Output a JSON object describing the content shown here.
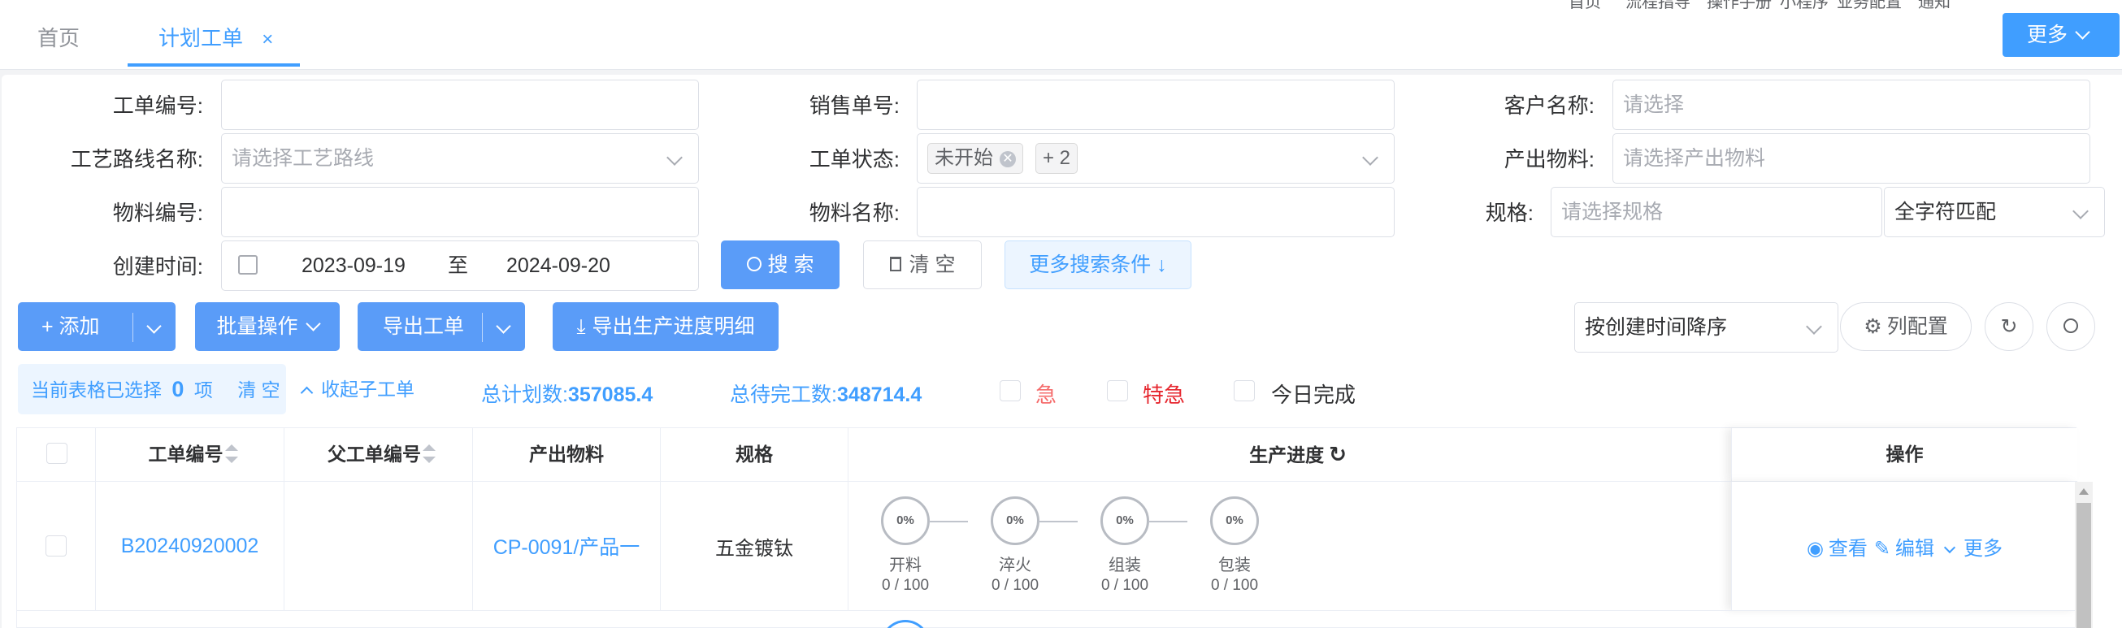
{
  "tabs": [
    {
      "label": "首页"
    },
    {
      "label": "计划工单",
      "close": "×"
    }
  ],
  "top_nav": [
    "首页",
    "流程指导",
    "操作手册",
    "小程序",
    "业务配置",
    "通知"
  ],
  "more_button": "更多",
  "filters": {
    "order_no": {
      "label": "工单编号:",
      "value": ""
    },
    "sales_no": {
      "label": "销售单号:",
      "value": ""
    },
    "customer": {
      "label": "客户名称:",
      "placeholder": "请选择"
    },
    "route": {
      "label": "工艺路线名称:",
      "placeholder": "请选择工艺路线"
    },
    "status": {
      "label": "工单状态:",
      "tag": "未开始",
      "more_tag": "+ 2"
    },
    "output_material": {
      "label": "产出物料:",
      "placeholder": "请选择产出物料"
    },
    "material_no": {
      "label": "物料编号:",
      "value": ""
    },
    "material_name": {
      "label": "物料名称:",
      "value": ""
    },
    "spec": {
      "label": "规格:",
      "placeholder": "请选择规格",
      "match": "全字符匹配"
    },
    "created": {
      "label": "创建时间:",
      "start": "2023-09-19",
      "to": "至",
      "end": "2024-09-20"
    }
  },
  "buttons": {
    "search": "搜 索",
    "clear": "清 空",
    "more_conditions": "更多搜索条件 ↓",
    "add": "+ 添加",
    "batch": "批量操作",
    "export": "导出工单",
    "export_progress": "导出生产进度明细",
    "column_config": "列配置"
  },
  "sort_select": "按创建时间降序",
  "selection": {
    "prefix": "当前表格已选择",
    "count": "0",
    "suffix": "项",
    "clear": "清 空",
    "collapse": "收起子工单"
  },
  "stats": {
    "total_plan_label": "总计划数:",
    "total_plan": "357085.4",
    "total_pending_label": "总待完工数:",
    "total_pending": "348714.4"
  },
  "flags": [
    {
      "label": "急",
      "color": "#f56c6c"
    },
    {
      "label": "特急",
      "color": "#e6262e"
    },
    {
      "label": "今日完成",
      "color": "#303133"
    }
  ],
  "table": {
    "headers": {
      "order_no": "工单编号",
      "parent_no": "父工单编号",
      "material": "产出物料",
      "spec": "规格",
      "progress": "生产进度",
      "ops": "操作"
    },
    "rows": [
      {
        "order_no": "B20240920002",
        "parent_no": "",
        "material": "CP-0091/产品一",
        "spec": "五金镀钛",
        "steps": [
          {
            "name": "开料",
            "pct": "0%",
            "count": "0 / 100"
          },
          {
            "name": "淬火",
            "pct": "0%",
            "count": "0 / 100"
          },
          {
            "name": "组装",
            "pct": "0%",
            "count": "0 / 100"
          },
          {
            "name": "包装",
            "pct": "0%",
            "count": "0 / 100"
          }
        ],
        "actions": {
          "view": "查看",
          "edit": "编辑",
          "more": "更多"
        }
      }
    ]
  },
  "colors": {
    "primary": "#409eff",
    "button": "#5a9cf8",
    "urgent": "#f56c6c"
  }
}
